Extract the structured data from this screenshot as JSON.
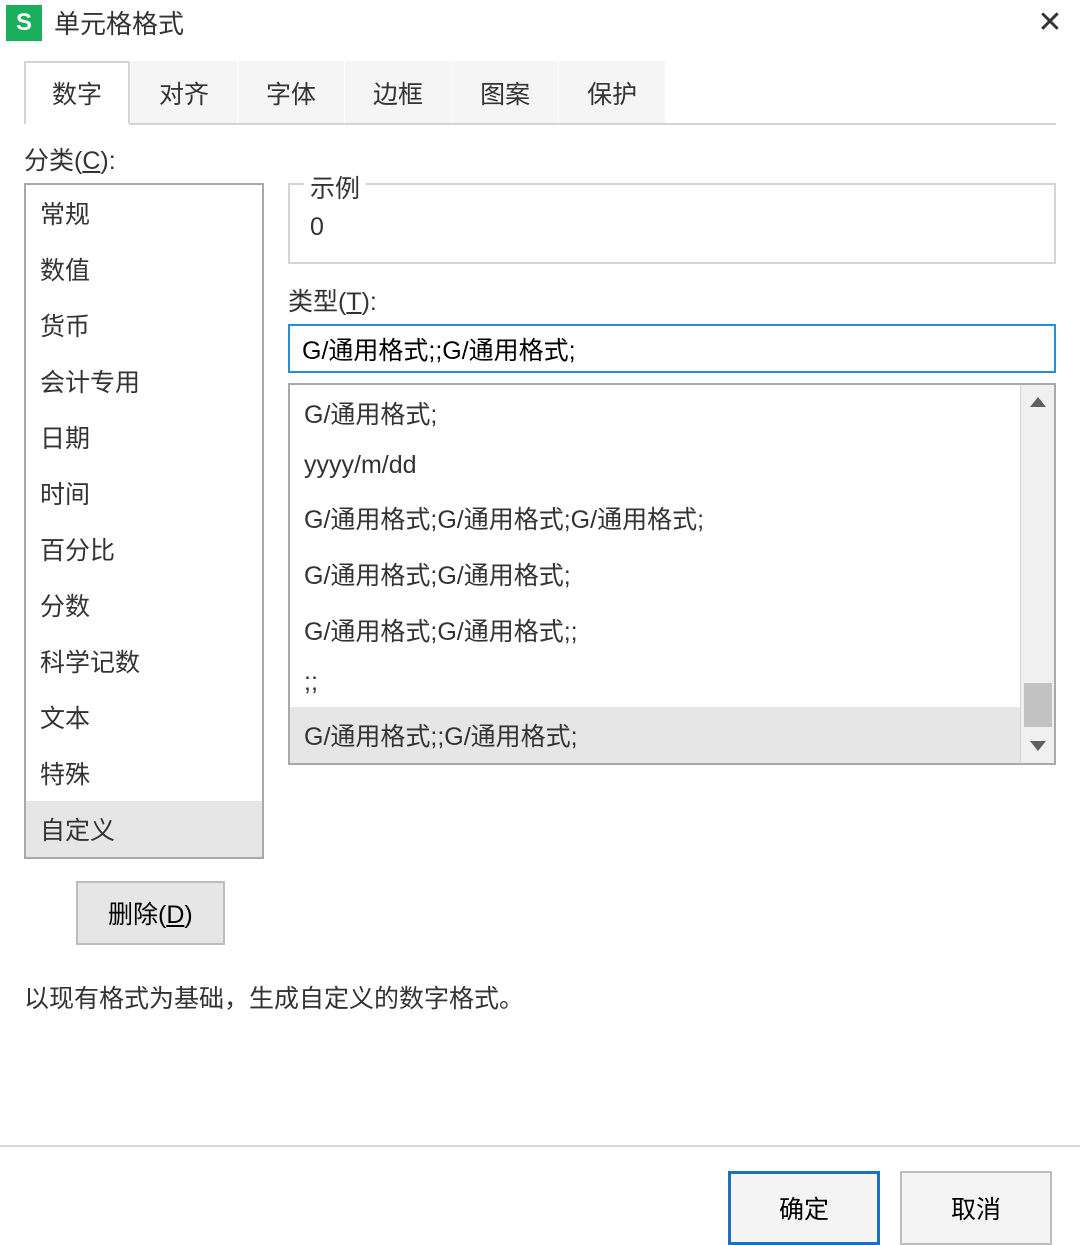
{
  "window": {
    "app_icon_letter": "S",
    "title": "单元格格式"
  },
  "tabs": [
    "数字",
    "对齐",
    "字体",
    "边框",
    "图案",
    "保护"
  ],
  "active_tab_index": 0,
  "category": {
    "label_pre": "分类(",
    "label_key": "C",
    "label_post": "):",
    "items": [
      "常规",
      "数值",
      "货币",
      "会计专用",
      "日期",
      "时间",
      "百分比",
      "分数",
      "科学记数",
      "文本",
      "特殊",
      "自定义"
    ],
    "selected_index": 11
  },
  "example": {
    "legend": "示例",
    "value": "0"
  },
  "type": {
    "label_pre": "类型(",
    "label_key": "T",
    "label_post": "):",
    "input_value": "G/通用格式;;G/通用格式;",
    "items": [
      "G/通用格式;",
      "yyyy/m/dd",
      "G/通用格式;G/通用格式;G/通用格式;",
      "G/通用格式;G/通用格式;",
      "G/通用格式;G/通用格式;;",
      ";;",
      "G/通用格式;;G/通用格式;"
    ],
    "selected_index": 6
  },
  "buttons": {
    "delete_pre": "删除(",
    "delete_key": "D",
    "delete_post": ")",
    "ok": "确定",
    "cancel": "取消"
  },
  "hint": "以现有格式为基础，生成自定义的数字格式。"
}
